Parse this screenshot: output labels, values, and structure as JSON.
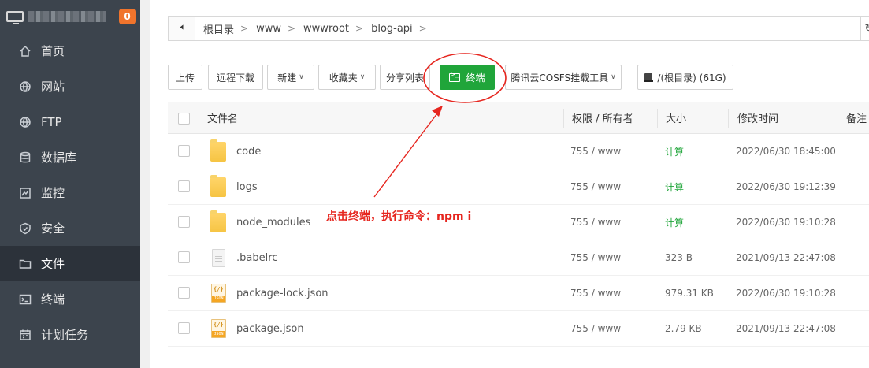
{
  "sidebar": {
    "badge": "0",
    "items": [
      {
        "label": "首页",
        "icon": "home-icon"
      },
      {
        "label": "网站",
        "icon": "globe-icon"
      },
      {
        "label": "FTP",
        "icon": "globe-icon"
      },
      {
        "label": "数据库",
        "icon": "database-icon"
      },
      {
        "label": "监控",
        "icon": "monitor-icon"
      },
      {
        "label": "安全",
        "icon": "shield-icon"
      },
      {
        "label": "文件",
        "icon": "folder-icon",
        "active": true
      },
      {
        "label": "终端",
        "icon": "terminal-icon"
      },
      {
        "label": "计划任务",
        "icon": "calendar-icon"
      }
    ]
  },
  "breadcrumb": [
    "根目录",
    "www",
    "wwwroot",
    "blog-api"
  ],
  "toolbar": {
    "upload": "上传",
    "remote_download": "远程下载",
    "new": "新建",
    "favorites": "收藏夹",
    "share_list": "分享列表",
    "terminal": "终端",
    "cosfs": "腾讯云COSFS挂载工具",
    "disk": "/(根目录) (61G)"
  },
  "table": {
    "headers": {
      "name": "文件名",
      "perm": "权限 / 所有者",
      "size": "大小",
      "mtime": "修改时间",
      "note": "备注"
    },
    "rows": [
      {
        "name": "code",
        "type": "folder",
        "perm": "755 / www",
        "size": "计算",
        "mtime": "2022/06/30 18:45:00"
      },
      {
        "name": "logs",
        "type": "folder",
        "perm": "755 / www",
        "size": "计算",
        "mtime": "2022/06/30 19:12:39"
      },
      {
        "name": "node_modules",
        "type": "folder",
        "perm": "755 / www",
        "size": "计算",
        "mtime": "2022/06/30 19:10:28"
      },
      {
        "name": ".babelrc",
        "type": "file",
        "perm": "755 / www",
        "size": "323 B",
        "mtime": "2021/09/13 22:47:08"
      },
      {
        "name": "package-lock.json",
        "type": "json",
        "perm": "755 / www",
        "size": "979.31 KB",
        "mtime": "2022/06/30 19:10:28"
      },
      {
        "name": "package.json",
        "type": "json",
        "perm": "755 / www",
        "size": "2.79 KB",
        "mtime": "2021/09/13 22:47:08"
      }
    ]
  },
  "annotation": {
    "text": "点击终端，执行命令：npm i",
    "color": "#e6261f"
  },
  "colors": {
    "accent": "#20a53a",
    "sidebar_bg": "#3c444d",
    "badge": "#f0742c"
  }
}
